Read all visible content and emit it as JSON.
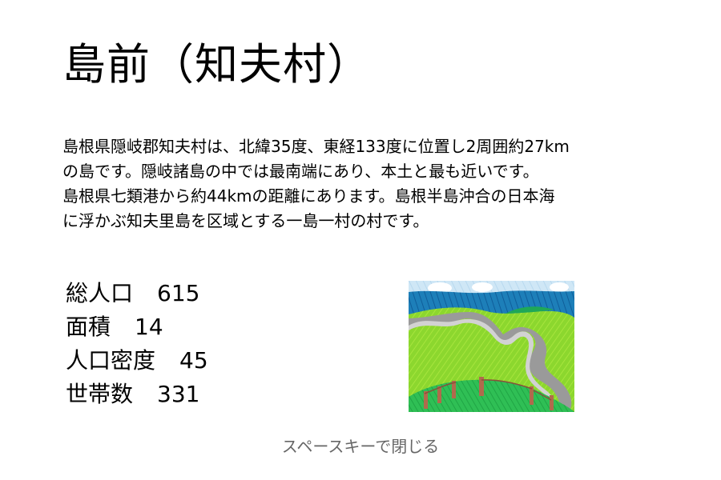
{
  "page": {
    "title": "島前（知夫村）",
    "description_lines": [
      "島根県隠岐郡知夫村は、北緯35度、東経133度に位置し2周囲約27km",
      "の島です。隠岐諸島の中では最南端にあり、本土と最も近いです。",
      "島根県七類港から約44kmの距離にあります。島根半島沖合の日本海",
      "に浮かぶ知夫里島を区域とする一島一村の村です。"
    ],
    "stats": [
      {
        "label": "総人口",
        "value": "615"
      },
      {
        "label": "面積",
        "value": "14"
      },
      {
        "label": "人口密度",
        "value": "45"
      },
      {
        "label": "世帯数",
        "value": "331"
      }
    ],
    "illustration": {
      "icon": "island-landscape-drawing",
      "colors": {
        "sky": "#cfe7f6",
        "cloud": "#ffffff",
        "sea": "#1d7fb9",
        "grass": "#8cd72e",
        "field": "#2fbf55",
        "road": "#9a9a9a",
        "fence": "#b06a4c"
      }
    },
    "hint": "スペースキーで閉じる",
    "colors": {
      "background": "#ffffff",
      "text": "#000000",
      "hint": "#666666"
    }
  }
}
